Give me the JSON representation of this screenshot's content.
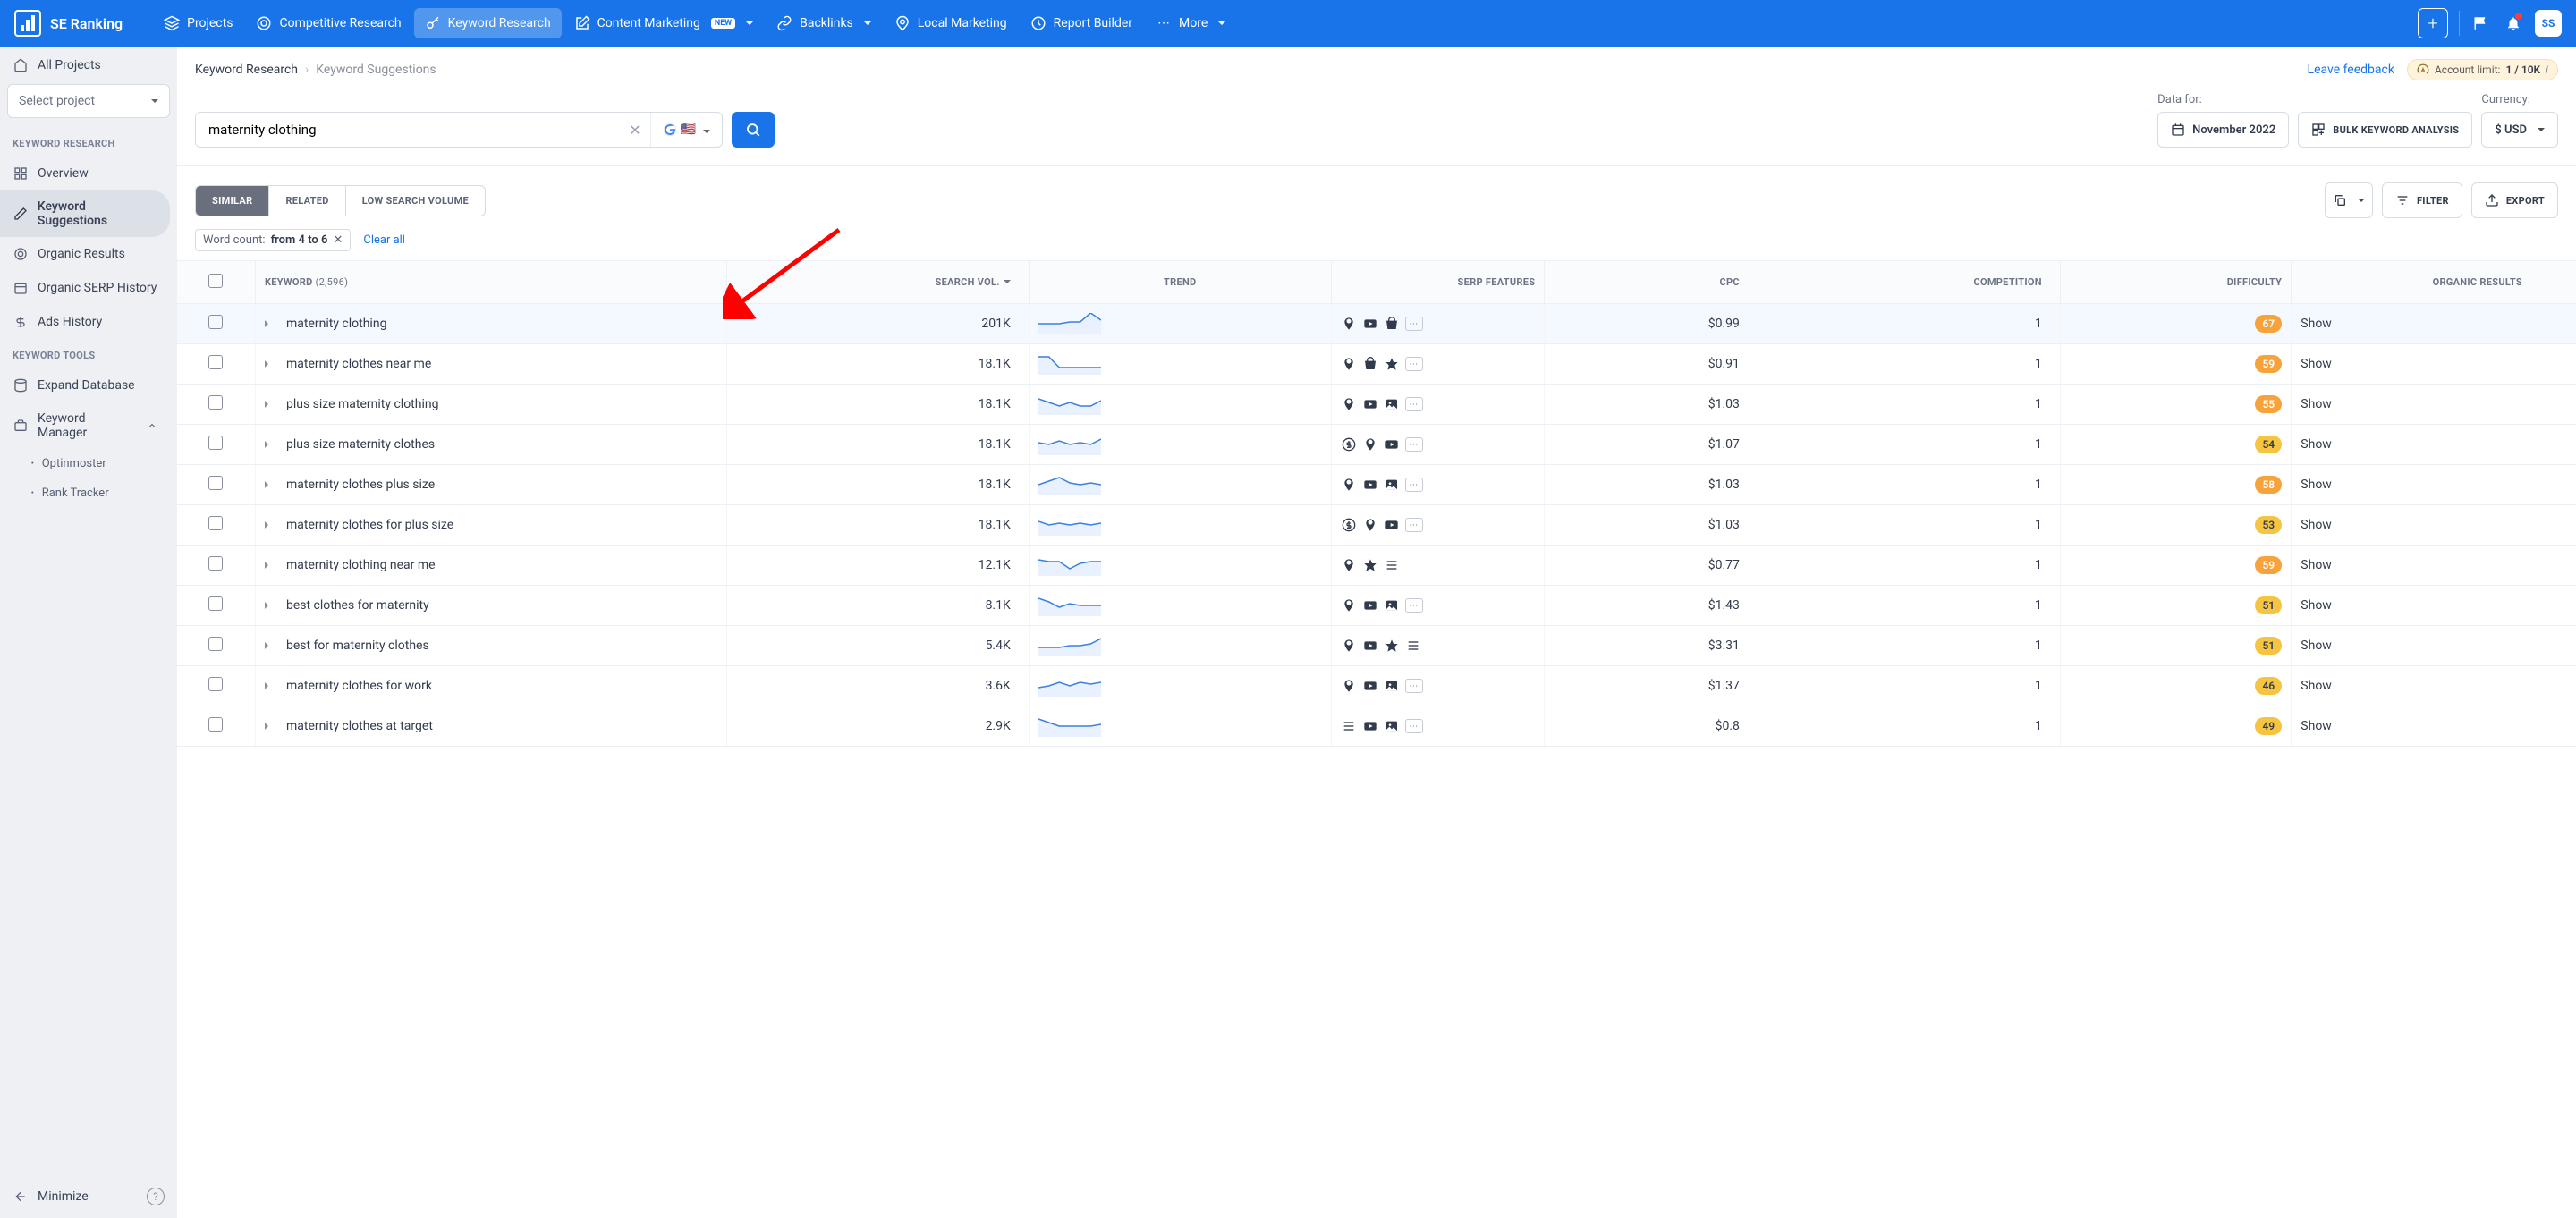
{
  "brand": "SE Ranking",
  "nav": {
    "projects": "Projects",
    "competitive": "Competitive Research",
    "keyword": "Keyword Research",
    "content": "Content Marketing",
    "content_badge": "NEW",
    "backlinks": "Backlinks",
    "local": "Local Marketing",
    "report": "Report Builder",
    "more": "More"
  },
  "avatar": "SS",
  "sidebar": {
    "all_projects": "All Projects",
    "select_project": "Select project",
    "section1": "KEYWORD RESEARCH",
    "overview": "Overview",
    "suggestions": "Keyword Suggestions",
    "organic_results": "Organic Results",
    "serp_history": "Organic SERP History",
    "ads_history": "Ads History",
    "section2": "KEYWORD TOOLS",
    "expand_db": "Expand Database",
    "kw_manager": "Keyword Manager",
    "sub1": "Optinmoster",
    "sub2": "Rank Tracker",
    "minimize": "Minimize"
  },
  "breadcrumb": {
    "root": "Keyword Research",
    "current": "Keyword Suggestions",
    "feedback": "Leave feedback",
    "limit_label": "Account limit:",
    "limit_val": "1 / 10K"
  },
  "search": {
    "value": "maternity clothing",
    "data_for": "Data for:",
    "date": "November 2022",
    "bulk": "BULK KEYWORD ANALYSIS",
    "currency_label": "Currency:",
    "currency": "$ USD"
  },
  "tabs": {
    "similar": "SIMILAR",
    "related": "RELATED",
    "low": "LOW SEARCH VOLUME"
  },
  "toolbar": {
    "filter": "FILTER",
    "export": "EXPORT"
  },
  "filter_chip": {
    "label": "Word count:",
    "value": "from 4 to 6",
    "clear": "Clear all"
  },
  "columns": {
    "keyword": "KEYWORD",
    "count": "(2,596)",
    "vol": "SEARCH VOL.",
    "trend": "TREND",
    "serp": "SERP FEATURES",
    "cpc": "CPC",
    "comp": "COMPETITION",
    "diff": "DIFFICULTY",
    "org": "ORGANIC RESULTS"
  },
  "rows": [
    {
      "kw": "maternity clothing",
      "vol": "201K",
      "cpc": "$0.99",
      "comp": "1",
      "diff": "67",
      "diffc": "orange",
      "serp": [
        "pin",
        "video",
        "bag",
        "more"
      ],
      "trend": [
        6,
        6,
        6,
        7,
        7,
        12,
        8
      ]
    },
    {
      "kw": "maternity clothes near me",
      "vol": "18.1K",
      "cpc": "$0.91",
      "comp": "1",
      "diff": "59",
      "diffc": "orange",
      "serp": [
        "pin",
        "bag",
        "star",
        "more"
      ],
      "trend": [
        10,
        10,
        4,
        4,
        4,
        4,
        4
      ]
    },
    {
      "kw": "plus size maternity clothing",
      "vol": "18.1K",
      "cpc": "$1.03",
      "comp": "1",
      "diff": "55",
      "diffc": "orange",
      "serp": [
        "pin",
        "video",
        "image",
        "more"
      ],
      "trend": [
        9,
        7,
        5,
        7,
        5,
        5,
        8
      ]
    },
    {
      "kw": "plus size maternity clothes",
      "vol": "18.1K",
      "cpc": "$1.07",
      "comp": "1",
      "diff": "54",
      "diffc": "yellow",
      "serp": [
        "dollar",
        "pin",
        "video",
        "more"
      ],
      "trend": [
        7,
        6,
        8,
        6,
        7,
        6,
        9
      ]
    },
    {
      "kw": "maternity clothes plus size",
      "vol": "18.1K",
      "cpc": "$1.03",
      "comp": "1",
      "diff": "58",
      "diffc": "orange",
      "serp": [
        "pin",
        "video",
        "image",
        "more"
      ],
      "trend": [
        6,
        8,
        10,
        7,
        6,
        7,
        6
      ]
    },
    {
      "kw": "maternity clothes for plus size",
      "vol": "18.1K",
      "cpc": "$1.03",
      "comp": "1",
      "diff": "53",
      "diffc": "yellow",
      "serp": [
        "dollar",
        "pin",
        "video",
        "more"
      ],
      "trend": [
        8,
        6,
        7,
        6,
        7,
        6,
        7
      ]
    },
    {
      "kw": "maternity clothing near me",
      "vol": "12.1K",
      "cpc": "$0.77",
      "comp": "1",
      "diff": "59",
      "diffc": "orange",
      "serp": [
        "pin",
        "star",
        "lines"
      ],
      "trend": [
        9,
        8,
        8,
        4,
        7,
        8,
        8
      ]
    },
    {
      "kw": "best clothes for maternity",
      "vol": "8.1K",
      "cpc": "$1.43",
      "comp": "1",
      "diff": "51",
      "diffc": "yellow",
      "serp": [
        "pin",
        "video",
        "image",
        "more"
      ],
      "trend": [
        10,
        8,
        5,
        7,
        6,
        6,
        6
      ]
    },
    {
      "kw": "best for maternity clothes",
      "vol": "5.4K",
      "cpc": "$3.31",
      "comp": "1",
      "diff": "51",
      "diffc": "yellow",
      "serp": [
        "pin",
        "video",
        "star",
        "lines"
      ],
      "trend": [
        5,
        5,
        5,
        6,
        6,
        7,
        10
      ]
    },
    {
      "kw": "maternity clothes for work",
      "vol": "3.6K",
      "cpc": "$1.37",
      "comp": "1",
      "diff": "46",
      "diffc": "yellow",
      "serp": [
        "pin",
        "video",
        "image",
        "more"
      ],
      "trend": [
        5,
        6,
        8,
        6,
        8,
        7,
        8
      ]
    },
    {
      "kw": "maternity clothes at target",
      "vol": "2.9K",
      "cpc": "$0.8",
      "comp": "1",
      "diff": "49",
      "diffc": "yellow",
      "serp": [
        "lines",
        "video",
        "image",
        "more"
      ],
      "trend": [
        10,
        8,
        6,
        6,
        6,
        6,
        7
      ]
    }
  ],
  "show_label": "Show"
}
